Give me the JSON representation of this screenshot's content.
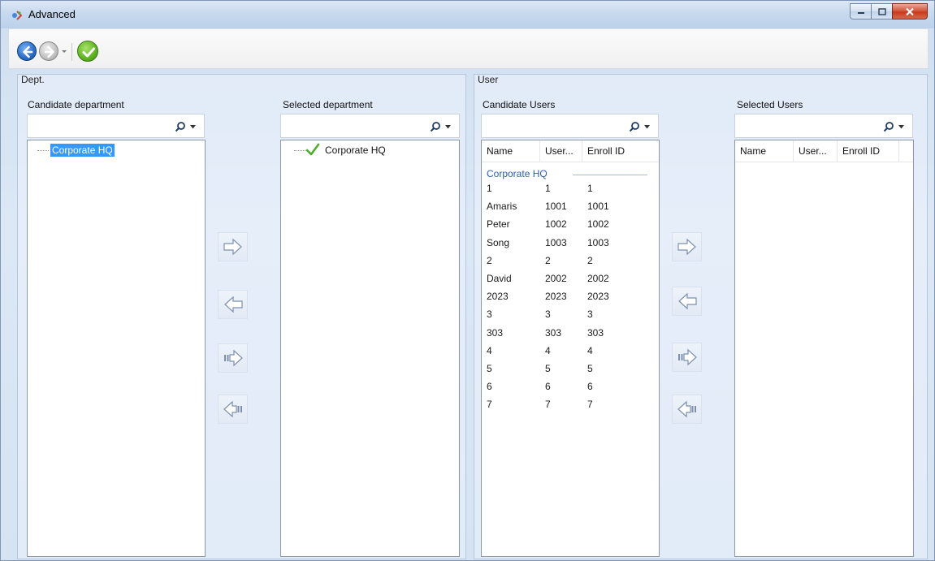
{
  "window": {
    "title": "Advanced",
    "colors": {
      "accent": "#3399ff",
      "group_text": "#2f5fb0",
      "close": "#c73a1d"
    }
  },
  "toolbar": {
    "back_icon": "back-arrow-icon",
    "forward_icon": "forward-arrow-icon",
    "confirm_icon": "checkmark-icon"
  },
  "dept": {
    "group_label": "Dept.",
    "candidate_label": "Candidate department",
    "selected_label": "Selected department",
    "candidate_search_value": "",
    "selected_search_value": "",
    "candidate_tree": [
      "Corporate HQ"
    ],
    "selected_tree": [
      "Corporate HQ"
    ]
  },
  "user": {
    "group_label": "User",
    "candidate_label": "Candidate Users",
    "selected_label": "Selected Users",
    "candidate_search_value": "",
    "selected_search_value": "",
    "columns": [
      "Name",
      "User...",
      "Enroll ID"
    ],
    "group_name": "Corporate HQ",
    "rows": [
      [
        "1",
        "1",
        "1"
      ],
      [
        "Amaris",
        "1001",
        "1001"
      ],
      [
        "Peter",
        "1002",
        "1002"
      ],
      [
        "Song",
        "1003",
        "1003"
      ],
      [
        "2",
        "2",
        "2"
      ],
      [
        "David",
        "2002",
        "2002"
      ],
      [
        "2023",
        "2023",
        "2023"
      ],
      [
        "3",
        "3",
        "3"
      ],
      [
        "303",
        "303",
        "303"
      ],
      [
        "4",
        "4",
        "4"
      ],
      [
        "5",
        "5",
        "5"
      ],
      [
        "6",
        "6",
        "6"
      ],
      [
        "7",
        "7",
        "7"
      ]
    ],
    "selected_rows": []
  },
  "transfer_buttons": {
    "icons": [
      "move-right-icon",
      "move-left-icon",
      "move-all-right-icon",
      "move-all-left-icon"
    ]
  }
}
